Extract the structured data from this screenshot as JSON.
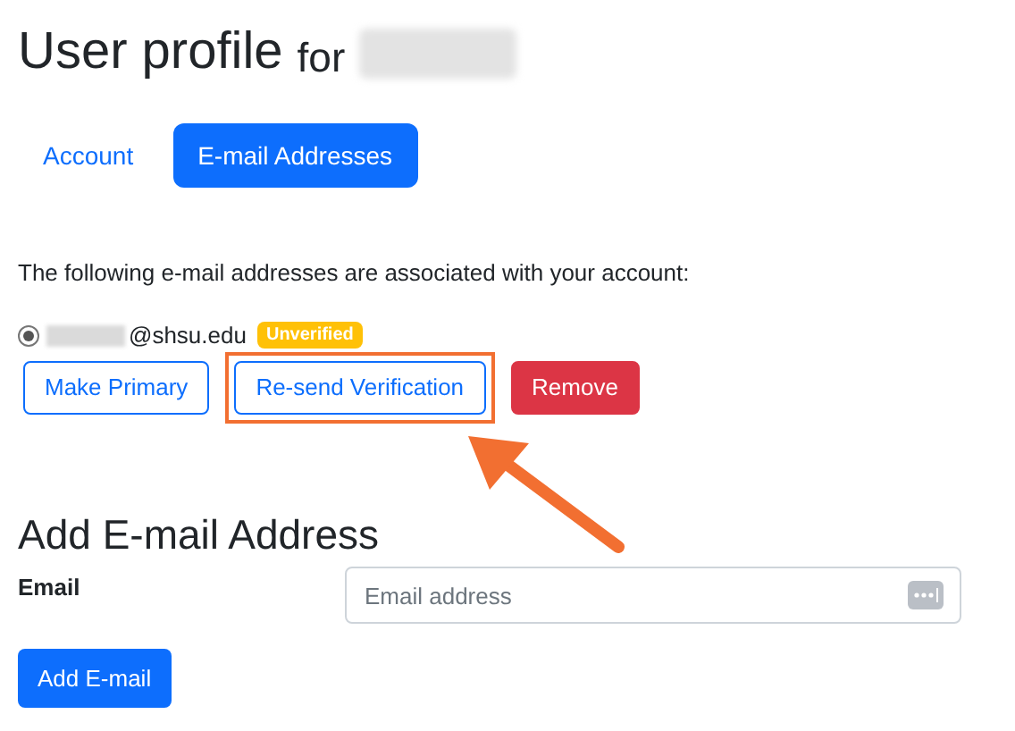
{
  "title": {
    "text": "User profile",
    "suffix": "for"
  },
  "tabs": [
    {
      "label": "Account",
      "selected": false
    },
    {
      "label": "E-mail Addresses",
      "selected": true
    }
  ],
  "intro": "The following e-mail addresses are associated with your account:",
  "emails": [
    {
      "address": "@shsu.edu",
      "selected": true,
      "badge": "Unverified"
    }
  ],
  "actions": [
    {
      "label": "Make Primary",
      "kind": "outline"
    },
    {
      "label": "Re-send Verification",
      "kind": "outline",
      "highlighted": true
    },
    {
      "label": "Remove",
      "kind": "danger"
    }
  ],
  "add": {
    "heading": "Add E-mail Address",
    "label": "Email",
    "placeholder": "Email address",
    "button": "Add E-mail"
  }
}
